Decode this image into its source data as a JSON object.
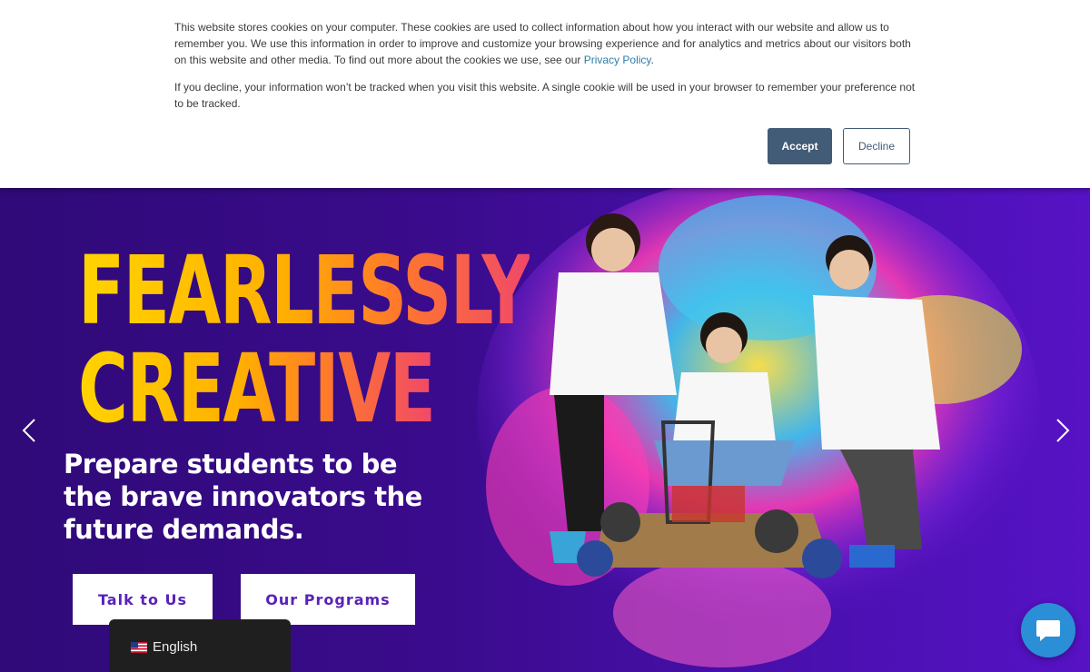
{
  "cookie_banner": {
    "text_p1_before_link": "This website stores cookies on your computer. These cookies are used to collect information about how you interact with our website and allow us to remember you. We use this information in order to improve and customize your browsing experience and for analytics and metrics about our visitors both on this website and other media. To find out more about the cookies we use, see our ",
    "privacy_link": "Privacy Policy",
    "text_p1_after_link": ".",
    "text_p2": "If you decline, your information won’t be tracked when you visit this website. A single cookie will be used in your browser to remember your preference not to be tracked.",
    "accept_label": "Accept",
    "decline_label": "Decline"
  },
  "hero": {
    "headline_line1": "FEARLESSLY",
    "headline_line2": "CREATIVE",
    "subheadline": "Prepare students to be the brave innovators the future demands.",
    "cta_primary": "Talk to Us",
    "cta_secondary": "Our Programs",
    "image_icon": "students-robot-car-photo"
  },
  "carousel": {
    "prev_icon": "chevron-left-icon",
    "next_icon": "chevron-right-icon"
  },
  "language_switcher": {
    "label": "English",
    "flag_icon": "us-flag-icon"
  },
  "chat": {
    "icon": "chat-bubble-icon"
  },
  "colors": {
    "accent_button": "#425b76",
    "link": "#2e7da8",
    "hero_bg": "#3a0b8c",
    "cta_text": "#5a22b8",
    "chat": "#2a8fd6"
  }
}
